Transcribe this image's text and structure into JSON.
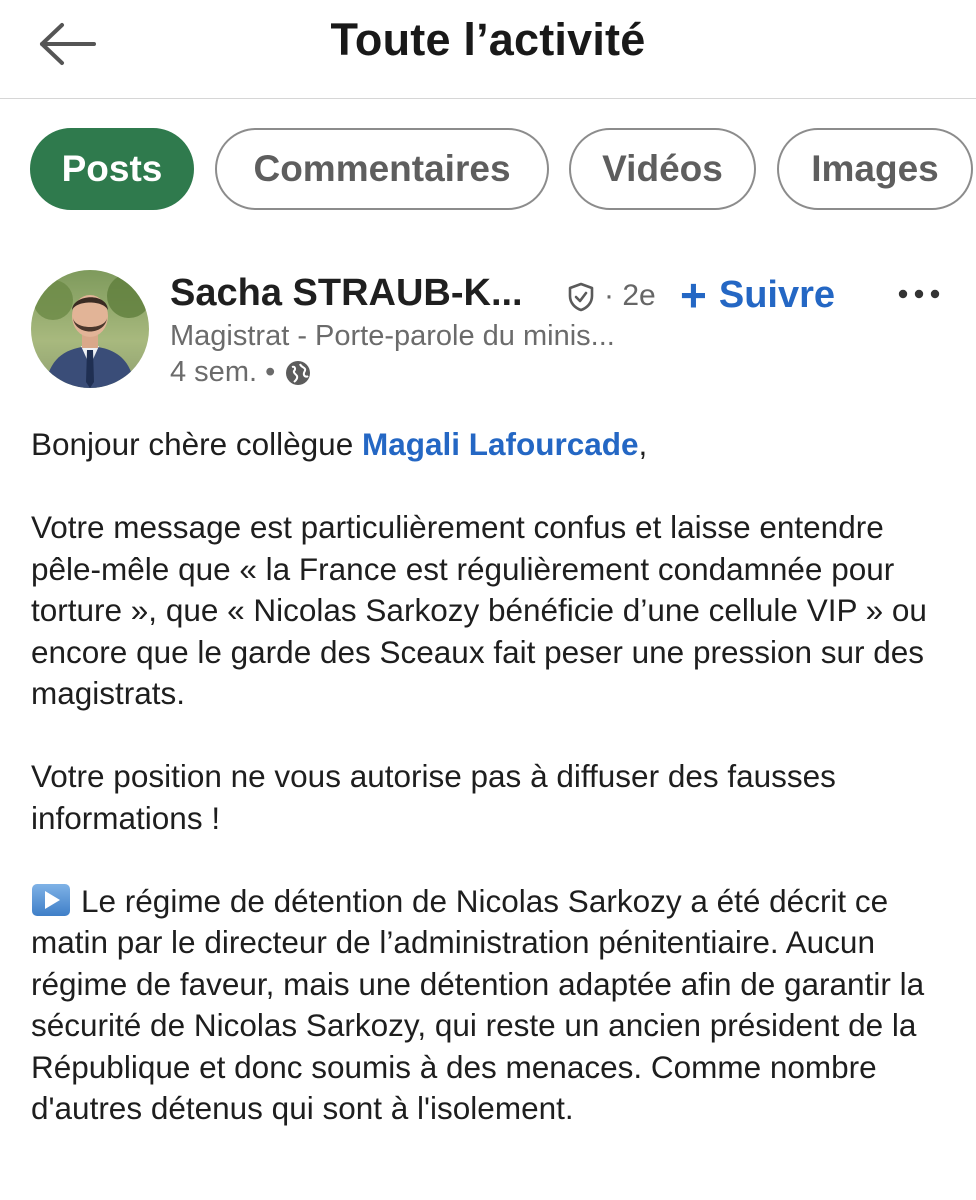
{
  "header": {
    "title": "Toute l’activité",
    "back_icon": "arrow-left-icon"
  },
  "tabs": [
    {
      "label": "Posts",
      "active": true
    },
    {
      "label": "Commentaires",
      "active": false
    },
    {
      "label": "Vidéos",
      "active": false
    },
    {
      "label": "Images",
      "active": false
    }
  ],
  "colors": {
    "active_tab": "#2f7a4d",
    "link": "#2467c4",
    "muted_text": "#6b6b6b"
  },
  "post": {
    "author": {
      "name": "Sacha STRAUB-K...",
      "verified_icon": "shield-check-icon",
      "connection_degree": "· 2e",
      "headline": "Magistrat - Porte-parole du minis...",
      "time": "4 sem. •",
      "visibility_icon": "globe-icon"
    },
    "follow_label": "Suivre",
    "more_icon": "more-dots-icon",
    "body": {
      "greeting_before": "Bonjour chère collègue ",
      "mention": "Magali Lafourcade",
      "greeting_after": ",",
      "paragraph_2": "Votre message est particulièrement confus et laisse entendre pêle-mêle que « la France est régulièrement condamnée pour torture », que « Nicolas Sarkozy bénéficie d’une cellule VIP » ou encore que le garde des Sceaux fait peser une pression sur des magistrats.",
      "paragraph_3": "Votre position ne vous autorise pas à diffuser des fausses informations !",
      "paragraph_4_icon": "play-button-emoji-icon",
      "paragraph_4": "Le régime de détention de Nicolas Sarkozy a été décrit ce matin par le directeur de l’administration pénitentiaire. Aucun régime de faveur, mais une détention adaptée afin de garantir la sécurité de Nicolas Sarkozy, qui reste un ancien président de la République et donc soumis à des menaces. Comme nombre d'autres détenus qui sont à l'isolement."
    }
  }
}
